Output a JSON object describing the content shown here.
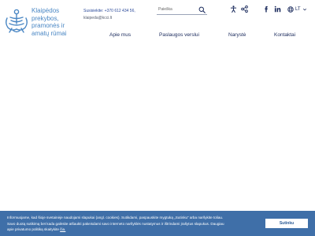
{
  "brand": {
    "name_lines": [
      "Klaipėdos",
      "prekybos,",
      "pramonės ir",
      "amatų rūmai"
    ],
    "color": "#4a87c4"
  },
  "contact": {
    "phone": "Susisiekite: +370 612 434 56,",
    "email": "klaipeda@kcci.lt"
  },
  "search": {
    "placeholder": "Paieška"
  },
  "header_icons": [
    "accessibility-icon",
    "share-icon",
    "facebook-icon",
    "linkedin-icon",
    "globe-icon"
  ],
  "language": {
    "selected": "LT"
  },
  "nav": {
    "items": [
      {
        "label": "Apie mus"
      },
      {
        "label": "Paslaugos verslui"
      },
      {
        "label": "Narystė"
      },
      {
        "label": "Kontaktai"
      }
    ]
  },
  "cookie_banner": {
    "line1": "Informuojame, kad šioje svetainėje naudojami slapukai (angl. cookies). Sutikdami, paspauskite mygtuką „Sutinku“ arba naršykite toliau.",
    "line2": "Savo duotą sutikimą bet kada galėsite atšaukti pakeisdami savo interneto naršyklės nustatymus ir ištrindami įrašytus slapukus. Daugiau",
    "line3_prefix": "apie privatumo politiką skaitykite ",
    "link_label": "čia.",
    "accept_label": "Sutinku",
    "background": "#3f6fa8"
  }
}
